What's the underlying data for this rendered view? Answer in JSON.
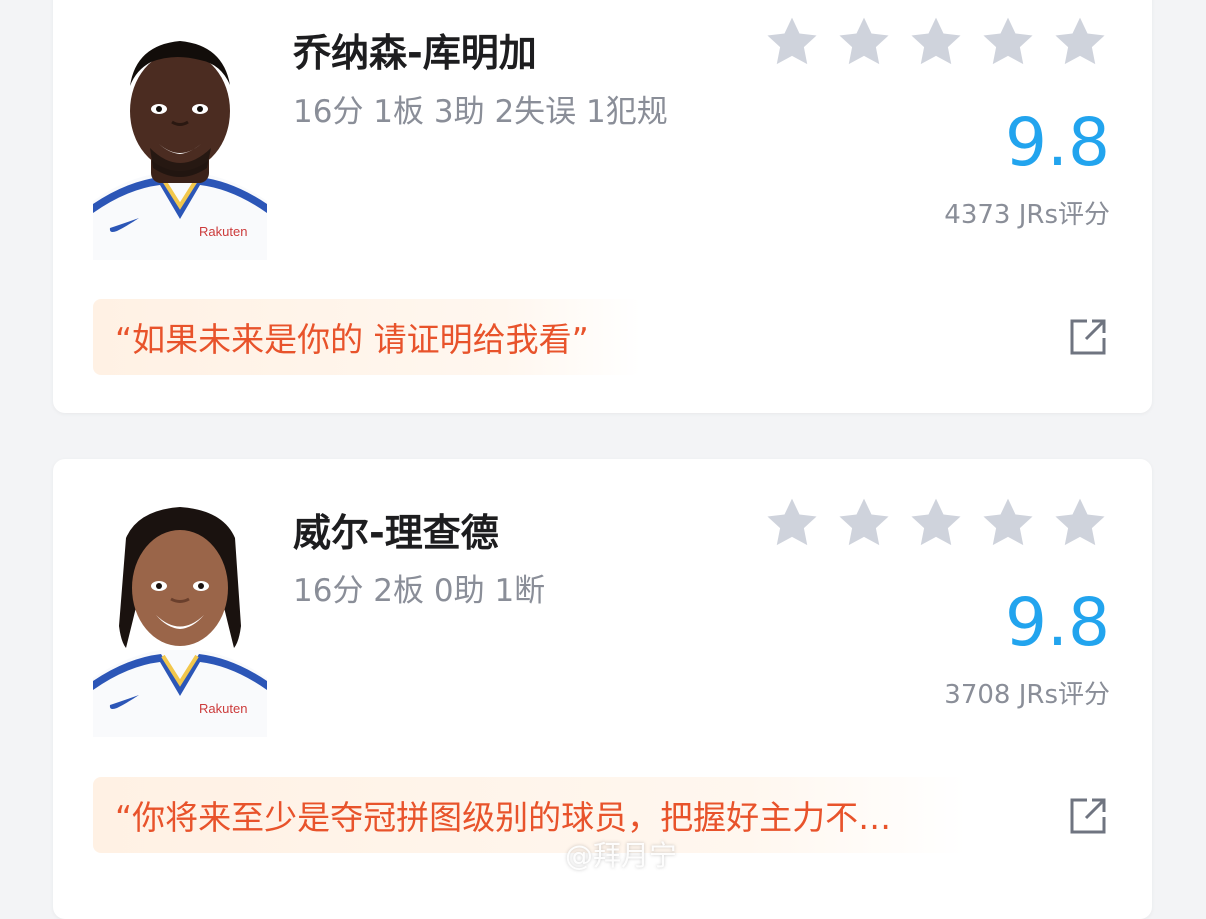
{
  "colors": {
    "score": "#22a4ee",
    "comment": "#e8532b",
    "star": "#cfd3dc",
    "secondary_text": "#8a8e98",
    "name": "#1d1d1f"
  },
  "cards": [
    {
      "name": "乔纳森-库明加",
      "stats": "16分 1板 3助 2失误 1犯规",
      "rating_stars": 5,
      "score": "9.8",
      "rating_count": "4373 JRs评分",
      "comment": "“如果未来是你的 请证明给我看”",
      "share_icon": "share-icon"
    },
    {
      "name": "威尔-理查德",
      "stats": "16分 2板 0助 1断",
      "rating_stars": 5,
      "score": "9.8",
      "rating_count": "3708 JRs评分",
      "comment": "“你将来至少是夺冠拼图级别的球员，把握好主力不…",
      "share_icon": "share-icon"
    }
  ],
  "watermark": "@拜月宁"
}
